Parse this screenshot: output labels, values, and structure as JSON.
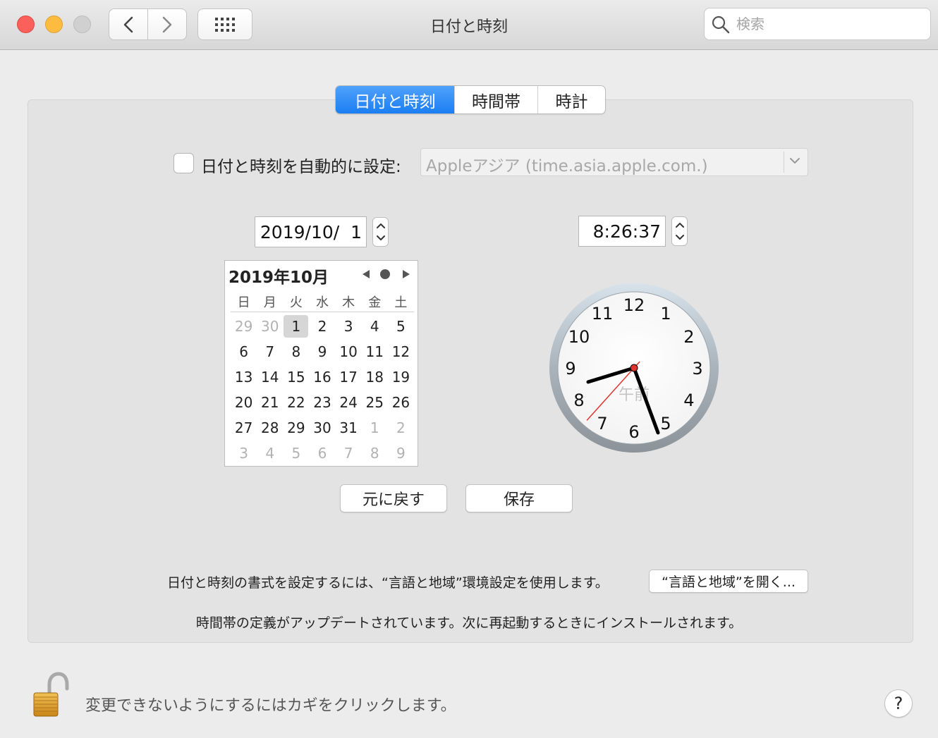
{
  "window": {
    "title": "日付と時刻",
    "search_placeholder": "検索"
  },
  "tabs": [
    {
      "label": "日付と時刻",
      "active": true
    },
    {
      "label": "時間帯",
      "active": false
    },
    {
      "label": "時計",
      "active": false
    }
  ],
  "auto_time": {
    "label": "日付と時刻を自動的に設定:",
    "checked": false,
    "server": "Appleアジア (time.asia.apple.com.)"
  },
  "date_field": "2019/10/  1",
  "time_field": "8:26:37",
  "calendar": {
    "title": "2019年10月",
    "weekdays": [
      "日",
      "月",
      "火",
      "水",
      "木",
      "金",
      "土"
    ],
    "weeks": [
      [
        {
          "d": "29",
          "o": true
        },
        {
          "d": "30",
          "o": true
        },
        {
          "d": "1",
          "sel": true
        },
        {
          "d": "2"
        },
        {
          "d": "3"
        },
        {
          "d": "4"
        },
        {
          "d": "5"
        }
      ],
      [
        {
          "d": "6"
        },
        {
          "d": "7"
        },
        {
          "d": "8"
        },
        {
          "d": "9"
        },
        {
          "d": "10"
        },
        {
          "d": "11"
        },
        {
          "d": "12"
        }
      ],
      [
        {
          "d": "13"
        },
        {
          "d": "14"
        },
        {
          "d": "15"
        },
        {
          "d": "16"
        },
        {
          "d": "17"
        },
        {
          "d": "18"
        },
        {
          "d": "19"
        }
      ],
      [
        {
          "d": "20"
        },
        {
          "d": "21"
        },
        {
          "d": "22"
        },
        {
          "d": "23"
        },
        {
          "d": "24"
        },
        {
          "d": "25"
        },
        {
          "d": "26"
        }
      ],
      [
        {
          "d": "27"
        },
        {
          "d": "28"
        },
        {
          "d": "29"
        },
        {
          "d": "30"
        },
        {
          "d": "31"
        },
        {
          "d": "1",
          "o": true
        },
        {
          "d": "2",
          "o": true
        }
      ],
      [
        {
          "d": "3",
          "o": true
        },
        {
          "d": "4",
          "o": true
        },
        {
          "d": "5",
          "o": true
        },
        {
          "d": "6",
          "o": true
        },
        {
          "d": "7",
          "o": true
        },
        {
          "d": "8",
          "o": true
        },
        {
          "d": "9",
          "o": true
        }
      ]
    ]
  },
  "clock": {
    "numbers": [
      "12",
      "1",
      "2",
      "3",
      "4",
      "5",
      "6",
      "7",
      "8",
      "9",
      "10",
      "11"
    ],
    "ampm": "午前",
    "hour": 8,
    "minute": 26,
    "second": 37
  },
  "buttons": {
    "revert": "元に戻す",
    "save": "保存",
    "open_language": "“言語と地域”を開く..."
  },
  "format_note": "日付と時刻の書式を設定するには、“言語と地域”環境設定を使用します。",
  "timezone_note": "時間帯の定義がアップデートされています。次に再起動するときにインストールされます。",
  "lock_text": "変更できないようにするにはカギをクリックします。",
  "help_label": "?",
  "colors": {
    "accent": "#1b7ef2",
    "second_hand": "#e0352f"
  }
}
